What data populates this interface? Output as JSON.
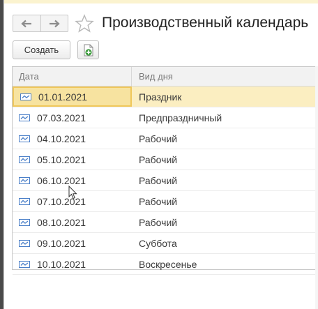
{
  "window": {
    "title": "Производственный календарь"
  },
  "nav": {
    "back_icon": "arrow-left-icon",
    "forward_icon": "arrow-right-icon",
    "favorite_icon": "star-icon"
  },
  "toolbar": {
    "create_label": "Создать",
    "add_icon": "add-document-icon"
  },
  "table": {
    "columns": [
      "Дата",
      "Вид дня"
    ],
    "row_icon": "record-icon",
    "rows": [
      {
        "date": "01.01.2021",
        "kind": "Праздник",
        "selected": true
      },
      {
        "date": "07.03.2021",
        "kind": "Предпраздничный"
      },
      {
        "date": "04.10.2021",
        "kind": "Рабочий"
      },
      {
        "date": "05.10.2021",
        "kind": "Рабочий"
      },
      {
        "date": "06.10.2021",
        "kind": "Рабочий"
      },
      {
        "date": "07.10.2021",
        "kind": "Рабочий"
      },
      {
        "date": "08.10.2021",
        "kind": "Рабочий"
      },
      {
        "date": "09.10.2021",
        "kind": "Суббота"
      },
      {
        "date": "10.10.2021",
        "kind": "Воскресенье"
      }
    ]
  },
  "colors": {
    "selection": "#fbeec1",
    "selection_border": "#f0c75a",
    "row_icon": "#4a7fc8",
    "add_icon": "#3a9a3a"
  }
}
